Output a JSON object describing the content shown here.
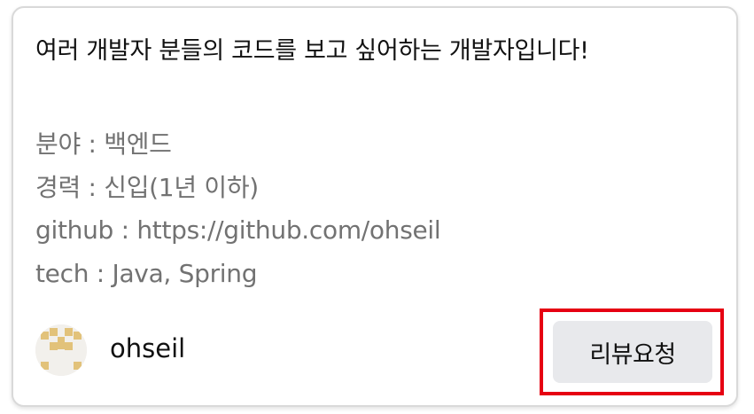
{
  "card": {
    "headline": "여러 개발자 분들의 코드를 보고 싶어하는 개발자입니다!",
    "details": [
      "분야 : 백엔드",
      "경력 : 신입(1년 이하)",
      "github : https://github.com/ohseil",
      "tech : Java, Spring"
    ]
  },
  "user": {
    "name": "ohseil",
    "avatar_icon": "identicon-avatar",
    "avatar_color": "#e2c27a"
  },
  "actions": {
    "review_request_label": "리뷰요청",
    "highlight_color": "#e60012"
  }
}
